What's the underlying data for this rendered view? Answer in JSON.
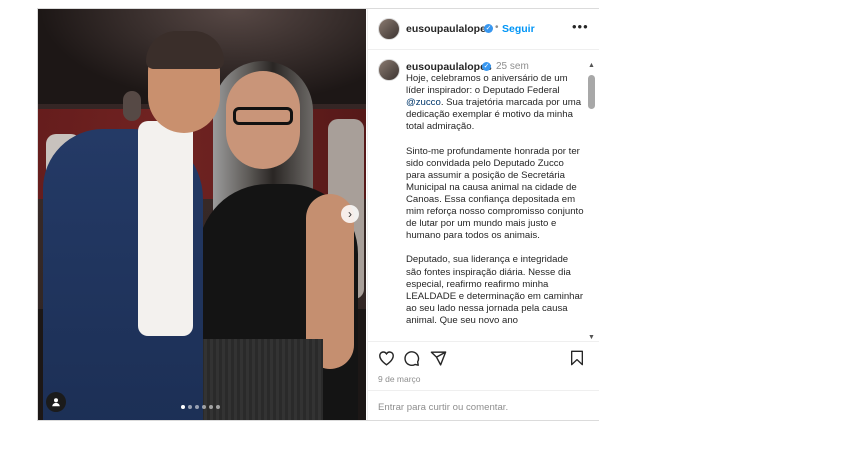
{
  "post": {
    "username": "eusoupaulalopes",
    "follow_label": "Seguir",
    "separator": "•",
    "time_ago": "25 sem",
    "caption_start": "Hoje, celebramos o aniversário de um líder inspirador: o Deputado Federal ",
    "mention": "@zucco",
    "caption_rest": ". Sua trajetória marcada por uma dedicação exemplar é motivo da minha total admiração.\n\nSinto-me profundamente honrada por ter sido convidada pelo Deputado Zucco para assumir a posição de Secretária Municipal na causa animal na cidade de Canoas. Essa confiança depositada em mim reforça nosso compromisso conjunto de lutar por um mundo mais justo e humano para todos os animais.\n\nDeputado, sua liderança e integridade são fontes inspiração diária. Nesse dia especial, reafirmo reafirmo minha LEALDADE e determinação em caminhar ao seu lado nessa jornada pela causa animal. Que seu novo ano",
    "date": "9 de março",
    "comment_placeholder": "Entrar para curtir ou comentar.",
    "carousel_total": 6,
    "carousel_active": 1
  },
  "icons": {
    "more": "more-options-icon",
    "like": "heart-icon",
    "comment": "comment-icon",
    "share": "share-icon",
    "save": "bookmark-icon",
    "next": "chevron-right-icon",
    "tag": "user-tag-icon",
    "verified": "verified-badge-icon"
  },
  "colors": {
    "link": "#0095f6",
    "verified": "#3897f0",
    "mention": "#00376b",
    "muted": "#8e8e8e"
  }
}
